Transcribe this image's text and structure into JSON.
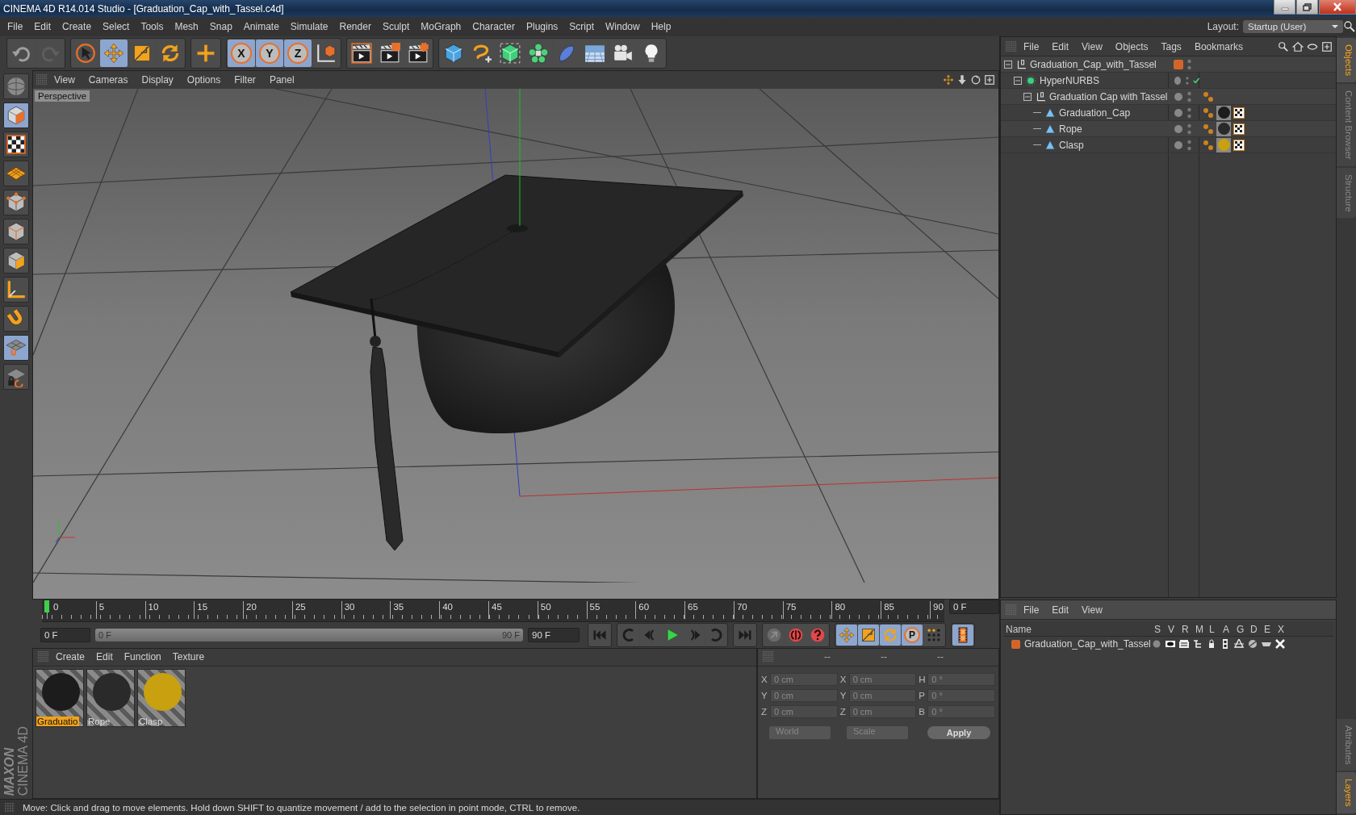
{
  "window": {
    "title": "CINEMA 4D R14.014 Studio - [Graduation_Cap_with_Tassel.c4d]"
  },
  "menubar": [
    "File",
    "Edit",
    "Create",
    "Select",
    "Tools",
    "Mesh",
    "Snap",
    "Animate",
    "Simulate",
    "Render",
    "Sculpt",
    "MoGraph",
    "Character",
    "Plugins",
    "Script",
    "Window",
    "Help"
  ],
  "layout": {
    "label": "Layout:",
    "value": "Startup (User)"
  },
  "toolbar": {
    "groups": [
      {
        "items": [
          {
            "kind": "undo",
            "active": false
          },
          {
            "kind": "redo",
            "active": false
          }
        ]
      },
      {
        "items": [
          {
            "kind": "select",
            "active": false
          },
          {
            "kind": "move",
            "active": true
          },
          {
            "kind": "scale",
            "active": false
          },
          {
            "kind": "rotate",
            "active": false
          }
        ]
      },
      {
        "items": [
          {
            "kind": "add",
            "active": false
          }
        ]
      },
      {
        "items": [
          {
            "kind": "axis",
            "label": "X",
            "active": true
          },
          {
            "kind": "axis",
            "label": "Y",
            "active": true
          },
          {
            "kind": "axis",
            "label": "Z",
            "active": true
          },
          {
            "kind": "coords",
            "active": false
          }
        ]
      },
      {
        "items": [
          {
            "kind": "render-view",
            "active": false
          },
          {
            "kind": "render",
            "active": false
          },
          {
            "kind": "render-settings",
            "active": false
          }
        ]
      },
      {
        "items": [
          {
            "kind": "cube",
            "active": false
          },
          {
            "kind": "spline",
            "active": false
          },
          {
            "kind": "nurbs",
            "active": false
          },
          {
            "kind": "array",
            "active": false
          },
          {
            "kind": "deformer",
            "active": false
          },
          {
            "kind": "floor",
            "active": false
          },
          {
            "kind": "camera",
            "active": false
          },
          {
            "kind": "light",
            "active": false
          }
        ]
      }
    ]
  },
  "tool_column": [
    {
      "kind": "model-sphere",
      "active": false
    },
    {
      "kind": "model",
      "active": true
    },
    {
      "kind": "texture",
      "active": false
    },
    {
      "kind": "workplane",
      "active": false
    },
    {
      "kind": "points",
      "active": false
    },
    {
      "kind": "edges",
      "active": false
    },
    {
      "kind": "polygons",
      "active": false
    },
    {
      "kind": "axis-mode",
      "active": false
    },
    {
      "kind": "magnet",
      "active": false
    },
    {
      "kind": "snap",
      "active": true
    },
    {
      "kind": "lock",
      "active": false
    }
  ],
  "viewport": {
    "menu": [
      "View",
      "Cameras",
      "Display",
      "Options",
      "Filter",
      "Panel"
    ],
    "label": "Perspective"
  },
  "timeline": {
    "ticks": [
      "0",
      "5",
      "10",
      "15",
      "20",
      "25",
      "30",
      "35",
      "40",
      "45",
      "50",
      "55",
      "60",
      "65",
      "70",
      "75",
      "80",
      "85",
      "90"
    ],
    "level": 0,
    "current_frame": "0 F",
    "start": "0 F",
    "range": {
      "start": "0 F",
      "end": "90 F",
      "level": 1
    },
    "end": "90 F"
  },
  "playback": {
    "groups": [
      {
        "items": [
          {
            "kind": "first",
            "active": false
          }
        ]
      },
      {
        "items": [
          {
            "kind": "prev-key",
            "active": false
          },
          {
            "kind": "prev",
            "active": false
          },
          {
            "kind": "play",
            "active": false
          },
          {
            "kind": "next",
            "active": false
          },
          {
            "kind": "next-key",
            "active": false
          }
        ]
      },
      {
        "items": [
          {
            "kind": "last",
            "active": false
          }
        ]
      },
      {
        "items": [
          {
            "kind": "record",
            "active": false
          },
          {
            "kind": "autokey",
            "active": false
          },
          {
            "kind": "help",
            "active": false
          }
        ]
      },
      {
        "items": [
          {
            "kind": "move",
            "active": true
          },
          {
            "kind": "scale",
            "active": true
          },
          {
            "kind": "rotate",
            "active": true
          },
          {
            "kind": "param",
            "label": "P",
            "active": true
          },
          {
            "kind": "points-grid",
            "active": false
          }
        ]
      },
      {
        "items": [
          {
            "kind": "film",
            "active": true
          }
        ]
      }
    ]
  },
  "materials": {
    "menu": [
      "Create",
      "Edit",
      "Function",
      "Texture"
    ],
    "items": [
      {
        "name": "Graduatio",
        "selected": true,
        "color": "#1c1c1c"
      },
      {
        "name": "Rope",
        "selected": false,
        "color": "#2a2a2a"
      },
      {
        "name": "Clasp",
        "selected": false,
        "color": "#c8a010"
      }
    ]
  },
  "coordinates": {
    "headers": [
      "--",
      "--",
      "--"
    ],
    "disabled": true,
    "columns": [
      [
        {
          "axis": "X",
          "value": "0 cm"
        },
        {
          "axis": "Y",
          "value": "0 cm"
        },
        {
          "axis": "Z",
          "value": "0 cm"
        }
      ],
      [
        {
          "axis": "X",
          "value": "0 cm"
        },
        {
          "axis": "Y",
          "value": "0 cm"
        },
        {
          "axis": "Z",
          "value": "0 cm"
        }
      ],
      [
        {
          "axis": "H",
          "value": "0 °"
        },
        {
          "axis": "P",
          "value": "0 °"
        },
        {
          "axis": "B",
          "value": "0 °"
        }
      ]
    ],
    "dropdowns": [
      "World",
      "Scale"
    ],
    "apply": "Apply"
  },
  "object_manager": {
    "menu": [
      "File",
      "Edit",
      "View",
      "Objects",
      "Tags",
      "Bookmarks"
    ],
    "tree": [
      {
        "name": "Graduation_Cap_with_Tassel",
        "kind": "null",
        "layer": {
          "color": "#d2662a"
        },
        "children": [
          {
            "name": "HyperNURBS",
            "kind": "nurbs",
            "enabled": true,
            "children": [
              {
                "name": "Graduation Cap with Tassel",
                "kind": "null",
                "children": [
                  {
                    "name": "Graduation_Cap",
                    "kind": "polygon",
                    "color": "#1c1c1c"
                  },
                  {
                    "name": "Rope",
                    "kind": "polygon",
                    "color": "#2a2a2a"
                  },
                  {
                    "name": "Clasp",
                    "kind": "polygon",
                    "color": "#c8a010"
                  }
                ]
              }
            ]
          }
        ]
      }
    ]
  },
  "side_tabs_top": [
    {
      "label": "Objects",
      "selected": true
    },
    {
      "label": "Content Browser",
      "selected": false
    },
    {
      "label": "Structure",
      "selected": false
    }
  ],
  "layer_manager": {
    "menu": [
      "File",
      "Edit",
      "View"
    ],
    "columns": [
      "Name",
      "S",
      "V",
      "R",
      "M",
      "L",
      "A",
      "G",
      "D",
      "E",
      "X"
    ],
    "rows": [
      {
        "name": "Graduation_Cap_with_Tassel",
        "color": "#d2662a"
      }
    ]
  },
  "side_tabs_bottom": [
    {
      "label": "Attributes",
      "selected": false
    },
    {
      "label": "Layers",
      "selected": true
    }
  ],
  "brand": {
    "company": "MAXON",
    "product": "CINEMA 4D"
  },
  "status_bar": "Move: Click and drag to move elements. Hold down SHIFT to quantize movement / add to the selection in point mode, CTRL to remove."
}
